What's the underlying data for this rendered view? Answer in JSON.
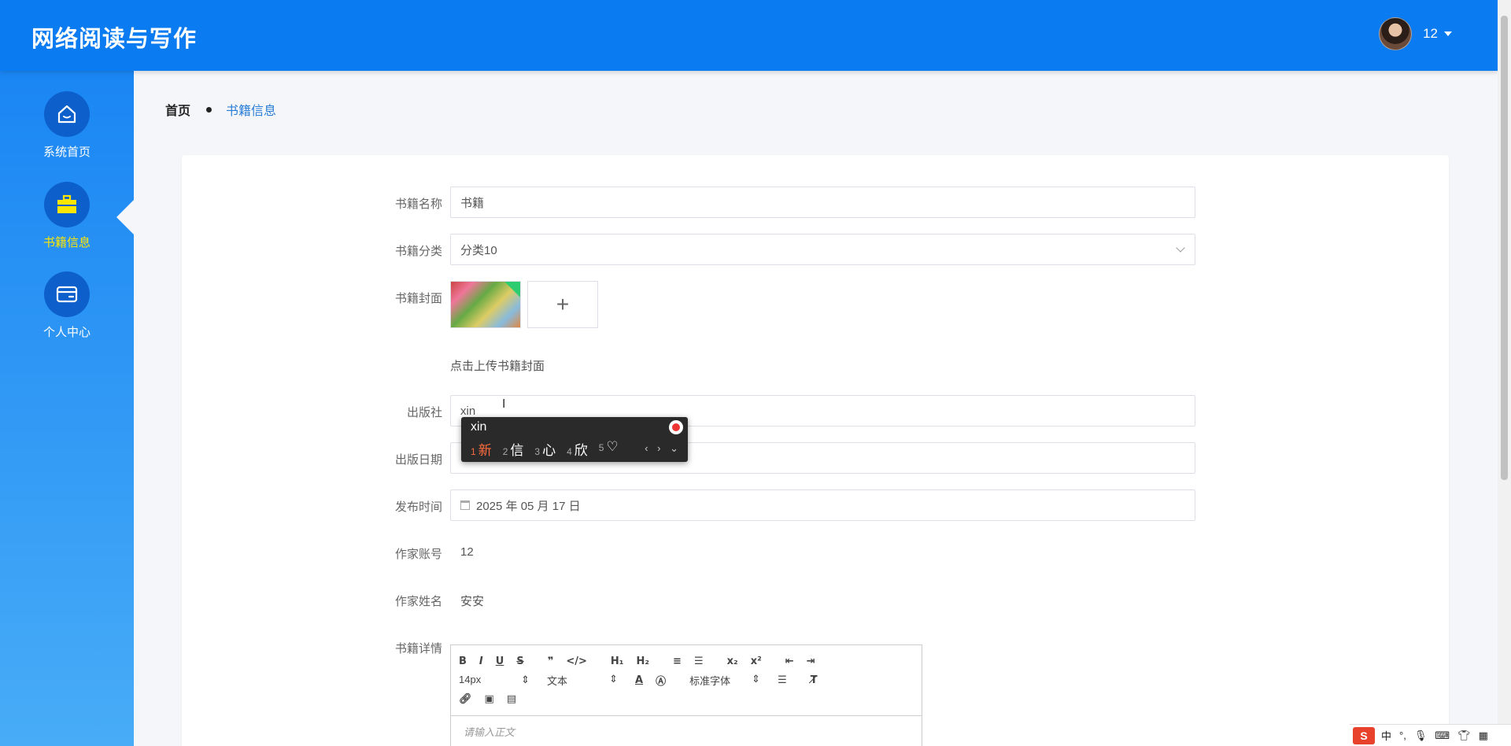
{
  "app": {
    "title": "网络阅读与写作"
  },
  "user": {
    "name": "12"
  },
  "sidebar": {
    "items": [
      {
        "label": "系统首页",
        "icon": "home-icon"
      },
      {
        "label": "书籍信息",
        "icon": "briefcase-icon",
        "active": true
      },
      {
        "label": "个人中心",
        "icon": "card-icon"
      }
    ]
  },
  "breadcrumb": {
    "home": "首页",
    "current": "书籍信息"
  },
  "form": {
    "book_name": {
      "label": "书籍名称",
      "value": "书籍"
    },
    "category": {
      "label": "书籍分类",
      "value": "分类10"
    },
    "cover": {
      "label": "书籍封面",
      "upload_symbol": "+",
      "hint": "点击上传书籍封面"
    },
    "publisher": {
      "label": "出版社",
      "value": "xin"
    },
    "publish_date": {
      "label": "出版日期",
      "value": ""
    },
    "release_time": {
      "label": "发布时间",
      "value": "2025 年 05 月 17 日"
    },
    "author_account": {
      "label": "作家账号",
      "value": "12"
    },
    "author_name": {
      "label": "作家姓名",
      "value": "安安"
    },
    "details": {
      "label": "书籍详情",
      "placeholder": "请输入正文",
      "toolbar": {
        "font_size": "14px",
        "header_select": "文本",
        "font_family": "标准字体"
      }
    }
  },
  "ime": {
    "pinyin": "xin",
    "candidates": [
      {
        "n": "1",
        "text": "新"
      },
      {
        "n": "2",
        "text": "信"
      },
      {
        "n": "3",
        "text": "心"
      },
      {
        "n": "4",
        "text": "欣"
      },
      {
        "n": "5",
        "text": "♡"
      }
    ],
    "nav": "‹ › ⌄"
  },
  "taskbar": {
    "ime_logo": "S",
    "mode": "中",
    "punct": "°,",
    "icons": [
      "mic-icon",
      "keyboard-icon",
      "shirt-icon",
      "grid-icon"
    ]
  },
  "colors": {
    "header": "#0a7bf0",
    "sidebar_top": "#1a86f3",
    "sidebar_bottom": "#48acf7",
    "active_label": "#ffe600",
    "link": "#2a7ed8"
  }
}
